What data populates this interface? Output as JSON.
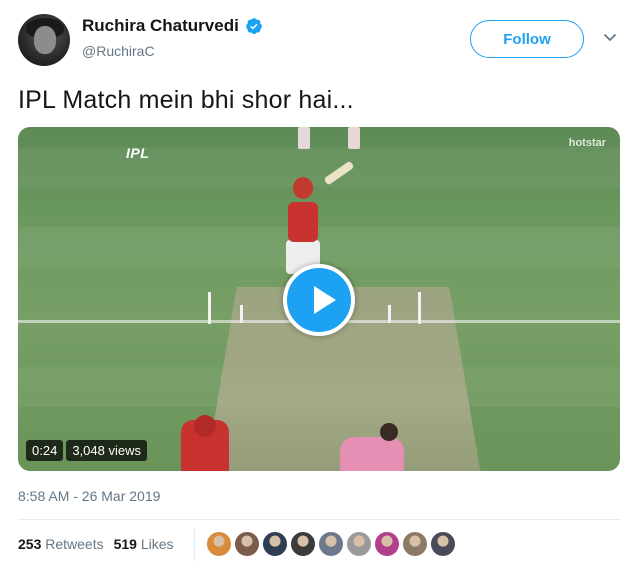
{
  "author": {
    "display_name": "Ruchira Chaturvedi",
    "handle": "@RuchiraC"
  },
  "header": {
    "follow_label": "Follow"
  },
  "tweet": {
    "text": "IPL Match mein bhi shor hai..."
  },
  "video": {
    "duration": "0:24",
    "views": "3,048 views",
    "logo_text": "IPL",
    "broadcaster": "hotstar"
  },
  "meta": {
    "timestamp": "8:58 AM - 26 Mar 2019"
  },
  "stats": {
    "retweets_count": "253",
    "retweets_label": "Retweets",
    "likes_count": "519",
    "likes_label": "Likes"
  },
  "colors": {
    "accent": "#1da1f2",
    "muted_text": "#657786",
    "primary_text": "#14171a"
  },
  "likers": [
    {
      "name": "liker-avatar-1",
      "color": "#d98a3a"
    },
    {
      "name": "liker-avatar-2",
      "color": "#7a5c4a"
    },
    {
      "name": "liker-avatar-3",
      "color": "#2f3e52"
    },
    {
      "name": "liker-avatar-4",
      "color": "#3b3b3b"
    },
    {
      "name": "liker-avatar-5",
      "color": "#6a7a8c"
    },
    {
      "name": "liker-avatar-6",
      "color": "#9a9a9a"
    },
    {
      "name": "liker-avatar-7",
      "color": "#b0408e"
    },
    {
      "name": "liker-avatar-8",
      "color": "#8a7a66"
    },
    {
      "name": "liker-avatar-9",
      "color": "#4a4a5a"
    }
  ]
}
